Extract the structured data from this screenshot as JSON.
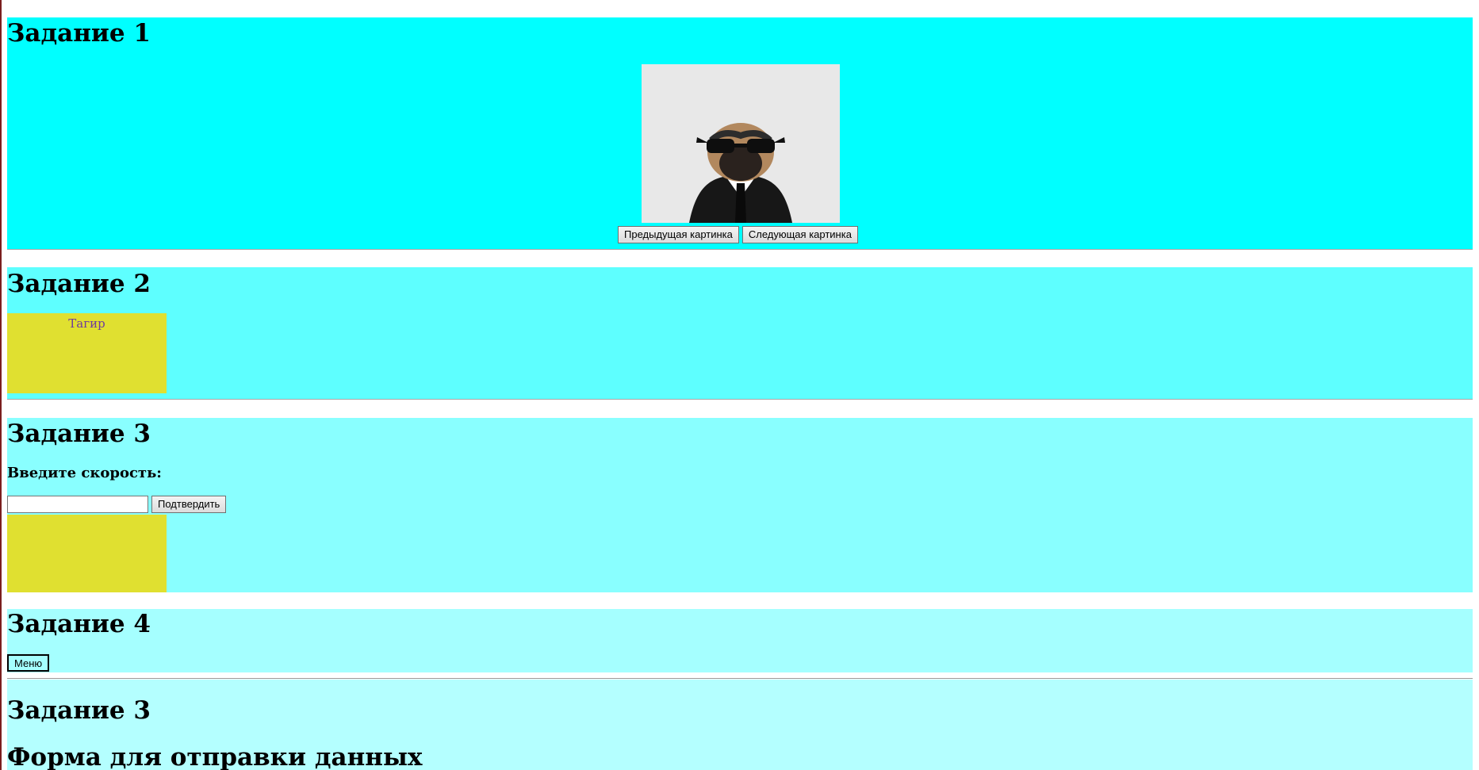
{
  "task1": {
    "title": "Задание 1",
    "prev_button": "Предыдущая картинка",
    "next_button": "Следующая картинка"
  },
  "task2": {
    "title": "Задание 2",
    "box_name": "Тагир"
  },
  "task3": {
    "title": "Задание 3",
    "speed_label": "Введите скорость:",
    "speed_value": "",
    "submit_button": "Подтвердить"
  },
  "task4": {
    "title": "Задание 4",
    "menu_button": "Меню"
  },
  "task5": {
    "title": "Задание 3",
    "form_title": "Форма для отправки данных"
  },
  "colors": {
    "section1": "#00ffff",
    "section2": "#5effff",
    "section3": "#89ffff",
    "section4": "#a5ffff",
    "section5": "#b4ffff",
    "yellow_box": "#e0e030",
    "name_text": "#6e3b9e"
  }
}
